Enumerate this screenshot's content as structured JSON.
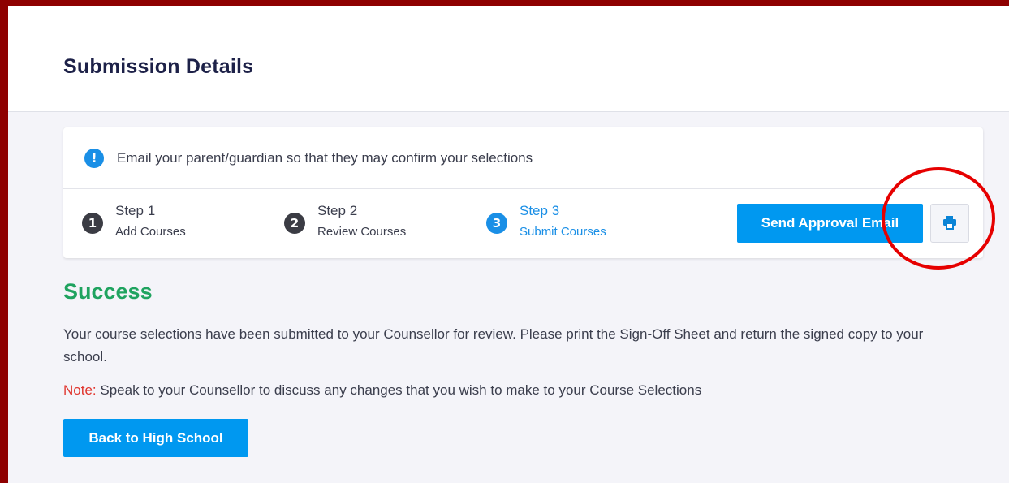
{
  "header": {
    "title": "Submission Details"
  },
  "alert": {
    "icon": "info-icon",
    "icon_glyph": "!",
    "text": "Email your parent/guardian so that they may confirm your selections"
  },
  "steps": [
    {
      "number": "1",
      "title": "Step 1",
      "subtitle": "Add Courses",
      "state": "complete"
    },
    {
      "number": "2",
      "title": "Step 2",
      "subtitle": "Review Courses",
      "state": "complete"
    },
    {
      "number": "3",
      "title": "Step 3",
      "subtitle": "Submit Courses",
      "state": "active"
    }
  ],
  "actions": {
    "send_label": "Send Approval Email",
    "print_icon": "printer-icon"
  },
  "success": {
    "title": "Success",
    "message": "Your course selections have been submitted to your Counsellor for review. Please print the Sign-Off Sheet and return the signed copy to your school.",
    "note_label": "Note:",
    "note_text": " Speak to your Counsellor to discuss any changes that you wish to make to your Course Selections",
    "back_label": "Back to High School"
  },
  "colors": {
    "accent": "#0098f0",
    "success": "#1fa35f",
    "note": "#e0352e",
    "title": "#1d2148",
    "annotation": "#e60000"
  }
}
